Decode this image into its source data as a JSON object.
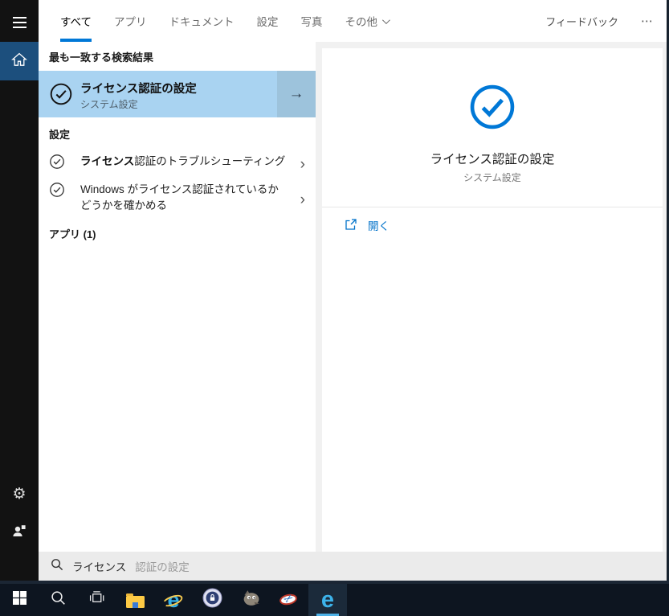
{
  "colors": {
    "accent": "#0078d7",
    "best_match_bg": "#a9d3f1",
    "arrow_button_bg": "#9dc3dc",
    "sidebar_selected_bg": "#1c4f7d",
    "taskbar_bg": "#0d1520",
    "link_blue": "#0072c9"
  },
  "sidebar": {
    "items": [
      "hamburger-menu",
      "home",
      "settings",
      "account"
    ]
  },
  "header": {
    "tabs": [
      {
        "label": "すべて",
        "active": true
      },
      {
        "label": "アプリ",
        "active": false
      },
      {
        "label": "ドキュメント",
        "active": false
      },
      {
        "label": "設定",
        "active": false
      },
      {
        "label": "写真",
        "active": false
      },
      {
        "label": "その他",
        "active": false,
        "has_dropdown": true
      }
    ],
    "feedback_label": "フィードバック",
    "more_label": "⋯"
  },
  "left_panel": {
    "best_match_header": "最も一致する検索結果",
    "best_match": {
      "title": "ライセンス認証の設定",
      "subtitle": "システム設定",
      "icon": "check-circle-icon",
      "arrow": "→"
    },
    "settings_header": "設定",
    "settings_items": [
      {
        "match": "ライセンス",
        "rest": "認証のトラブルシューティング",
        "icon": "check-circle-icon",
        "chevron": "›"
      },
      {
        "match": "",
        "rest": "Windows がライセンス認証されているかどうかを確かめる",
        "icon": "check-circle-icon",
        "chevron": "›"
      }
    ],
    "apps_header": "アプリ (1)"
  },
  "preview": {
    "icon": "check-circle-icon",
    "title": "ライセンス認証の設定",
    "subtitle": "システム設定",
    "open_label": "開く",
    "open_icon": "open-external-icon"
  },
  "search_bar": {
    "icon": "search-icon",
    "typed": "ライセンス",
    "suggestion": "認証の設定"
  },
  "taskbar": {
    "icons": [
      "start",
      "search",
      "task-view",
      "file-explorer",
      "internet-explorer",
      "keepass",
      "gimp",
      "snipping-tool",
      "edge"
    ],
    "active": "edge"
  }
}
